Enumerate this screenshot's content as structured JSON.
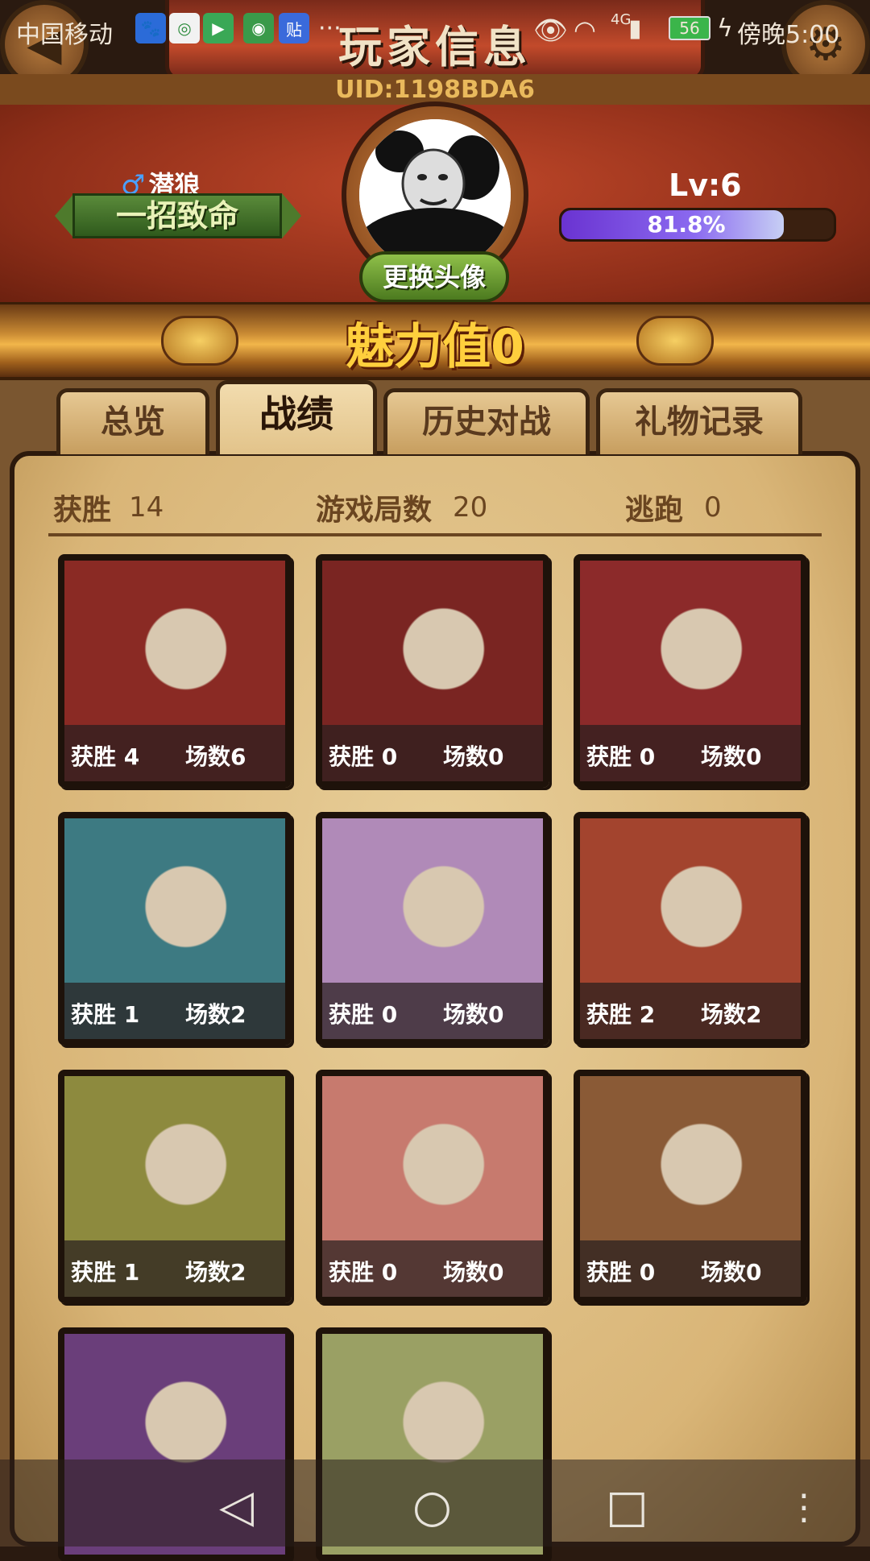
{
  "status_bar": {
    "carrier": "中国移动",
    "more": "···",
    "network": "4G",
    "battery": "56",
    "time": "傍晚5:00"
  },
  "header": {
    "title": "玩家信息",
    "uid": "UID:1198BDA6"
  },
  "profile": {
    "gender_symbol": "♂",
    "nickname": "潜狼",
    "title_plate": "一招致命",
    "level": "Lv:6",
    "xp_percent_text": "81.8%",
    "xp_fraction": 0.818,
    "change_avatar_label": "更换头像",
    "charm_label": "魅力值0"
  },
  "tabs": [
    {
      "label": "总览"
    },
    {
      "label": "战绩"
    },
    {
      "label": "历史对战"
    },
    {
      "label": "礼物记录"
    }
  ],
  "stats": {
    "wins_label": "获胜",
    "wins_value": "14",
    "games_label": "游戏局数",
    "games_value": "20",
    "escape_label": "逃跑",
    "escape_value": "0"
  },
  "cards": [
    {
      "win": "获胜 4",
      "games": "场数6",
      "bg": "#8a2a24"
    },
    {
      "win": "获胜 0",
      "games": "场数0",
      "bg": "#7a2522"
    },
    {
      "win": "获胜 0",
      "games": "场数0",
      "bg": "#8c2a2a"
    },
    {
      "win": "获胜 1",
      "games": "场数2",
      "bg": "#3d7a82"
    },
    {
      "win": "获胜 0",
      "games": "场数0",
      "bg": "#b08ab8"
    },
    {
      "win": "获胜 2",
      "games": "场数2",
      "bg": "#a3442e"
    },
    {
      "win": "获胜 1",
      "games": "场数2",
      "bg": "#8d8a3e"
    },
    {
      "win": "获胜 0",
      "games": "场数0",
      "bg": "#c77a6e"
    },
    {
      "win": "获胜 0",
      "games": "场数0",
      "bg": "#8a5a36"
    },
    {
      "win": "",
      "games": "",
      "bg": "#6a3e7a"
    },
    {
      "win": "",
      "games": "",
      "bg": "#9aa064"
    }
  ]
}
